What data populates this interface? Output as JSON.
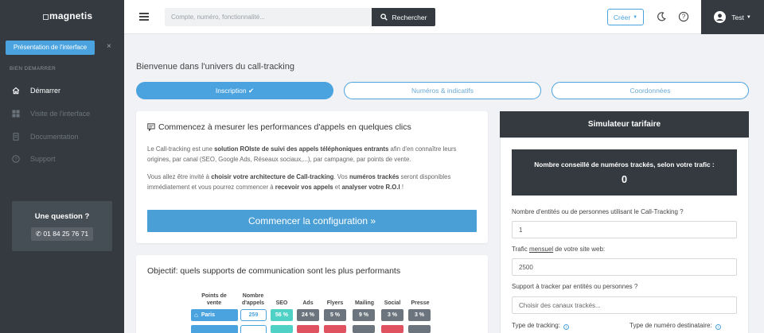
{
  "sidebar": {
    "logo_text": "magnetis",
    "tour_button": "Présentation de l'interface",
    "tour_close": "×",
    "section_title": "BIEN DEMARRER",
    "items": [
      {
        "label": "Démarrer",
        "icon": "home-icon",
        "active": true
      },
      {
        "label": "Visite de l'interface",
        "icon": "grid-icon",
        "active": false
      },
      {
        "label": "Documentation",
        "icon": "document-icon",
        "active": false
      },
      {
        "label": "Support",
        "icon": "help-circle-icon",
        "active": false
      }
    ],
    "question": {
      "title": "Une question ?",
      "phone": "01 84 25 76 71"
    }
  },
  "topbar": {
    "search_placeholder": "Compte, numéro, fonctionnalité...",
    "search_button": "Rechercher",
    "create_button": "Créer",
    "user_name": "Test"
  },
  "main": {
    "welcome": "Bienvenue dans l'univers du call-tracking",
    "steps": [
      {
        "label": "Inscription ✔",
        "active": true
      },
      {
        "label": "Numéros & indicatifs",
        "active": false
      },
      {
        "label": "Coordonnées",
        "active": false
      }
    ],
    "intro_card": {
      "title": "Commencez à mesurer les performances d'appels en quelques clics",
      "p1_a": "Le Call-tracking est une ",
      "p1_b": "solution ROIste de suivi des appels téléphoniques entrants",
      "p1_c": " afin d'en connaître leurs origines, par canal (SEO, Google Ads, Réseaux sociaux,...), par campagne, par points de vente.",
      "p2_a": "Vous allez être invité à ",
      "p2_b": "choisir votre architecture de Call-tracking",
      "p2_c": ". Vos ",
      "p2_d": "numéros trackés",
      "p2_e": " seront disponibles immédiatement et vous pourrez commencer à ",
      "p2_f": "recevoir vos appels",
      "p2_g": " et ",
      "p2_h": "analyser votre R.O.I",
      "p2_i": " !",
      "button": "Commencer la configuration »"
    },
    "objective_card": {
      "title": "Objectif: quels supports de communication sont les plus performants",
      "headers": {
        "points": "Points de vente",
        "calls": "Nombre d'appels",
        "seo": "SEO",
        "ads": "Ads",
        "flyers": "Flyers",
        "mailing": "Mailing",
        "social": "Social",
        "presse": "Presse"
      },
      "row": {
        "city": "Paris",
        "calls": "259",
        "seo": "56 %",
        "ads": "24 %",
        "flyers": "5 %",
        "mailing": "9 %",
        "social": "3 %",
        "presse": "3 %"
      },
      "colors": {
        "seo": "#4fd1c5",
        "gray": "#6c757d",
        "red": "#e05260",
        "blue": "#4aa3df"
      }
    }
  },
  "simulator": {
    "title": "Simulateur tarifaire",
    "result_label": "Nombre conseillé de numéros trackés, selon votre trafic :",
    "result_value": "0",
    "field1_label": "Nombre d'entités ou de personnes utilisant le Call-Tracking ?",
    "field1_value": "1",
    "field2_label_a": "Trafic ",
    "field2_label_b": "mensuel",
    "field2_label_c": " de votre site web:",
    "field2_value": "2500",
    "field3_label": "Support à tracker par entités ou personnes ?",
    "field3_placeholder": "Choisir des canaux trackés...",
    "field4_label": "Type de tracking:",
    "field5_label": "Type de numéro destinataire:"
  }
}
